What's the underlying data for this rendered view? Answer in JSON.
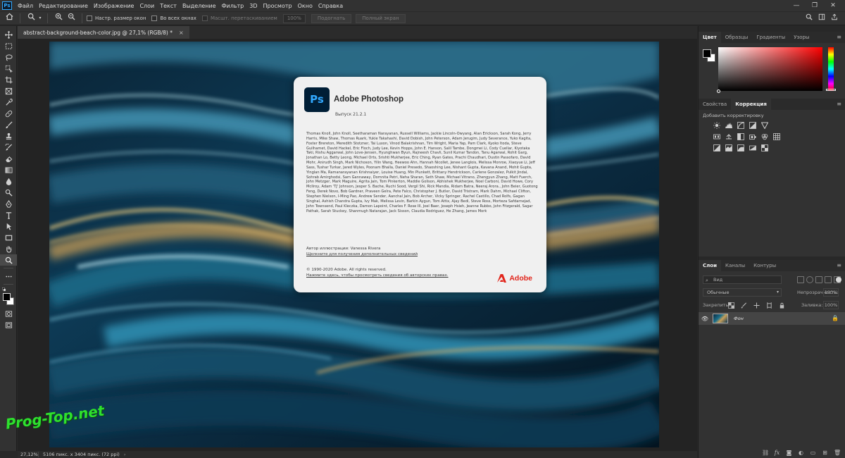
{
  "menubar": {
    "logo": "Ps",
    "items": [
      "Файл",
      "Редактирование",
      "Изображение",
      "Слои",
      "Текст",
      "Выделение",
      "Фильтр",
      "3D",
      "Просмотр",
      "Окно",
      "Справка"
    ],
    "win": {
      "minimize": "—",
      "maximize": "❐",
      "close": "✕"
    }
  },
  "options": {
    "resize_windows": "Настр. размер окон",
    "all_windows": "Во всех окнах",
    "scrubby_zoom": "Масшт. перетаскиванием",
    "zoom_value": "100%",
    "fit_screen": "Подогнать",
    "fill_screen": "Полный экран"
  },
  "document": {
    "tab_title": "abstract-background-beach-color.jpg @ 27,1% (RGB/8) *",
    "close": "×"
  },
  "about": {
    "ps_icon": "Ps",
    "title": "Adobe Photoshop",
    "version": "Выпуск 21.2.1",
    "credits": "Thomas Knoll, John Knoll, Seetharaman Narayanan, Russell Williams, Jackie Lincoln-Owyang, Alan Erickson, Sarah Kong, Jerry Harris, Mike Shaw, Thomas Ruark, Yukie Takahashi, David Dobish, John Peterson, Adam Jerugim, Judy Severance, Yuko Kagita, Foster Brereton, Meredith Stotzner, Tai Luxon, Vinod Balakrishnan, Tim Wright, Maria Yap, Pam Clark, Kyoko Itoda, Steve Guilhamet, David Hackel, Eric Floch, Judy Lee, Kevin Hopps, John E. Hanson, Salil Tambe, Dongmei Li, Cody Cuellar, Kiyotaka Taki, Rishu Aggarwal, John Love-Jensen, Hyunghwan Byun, Rajneesh Chavli, Sunil Kumar Tandon, Tanu Agarwal, Rohit Garg, Jonathan Lo, Betty Leong, Michael Orts, Srishti Mukherjee, Eric Ching, Ryan Gates, Prachi Chaudhari, Dustin Passofaro, David Mohr, Anirudh Singh, Mark Nichoson, Yilin Wang, Heewoo Ahn, Hannah Nicollet, Jenee Langlois, Melissa Monroe, Xiaoyue Li, Jeff Sass, Tushar Turkar, Jared Wyles, Poonam Bhalla, Daniel Presedo, Shaoshing Lee, Nishant Gupta, Kavana Anand, Mohit Gupta, Yinglan Ma, Ramanarayanan Krishnaiyer, Louise Huang, Min Plunkett, Brittany Hendrickson, Carlene Gonzalez, Pulkit Jindal, Sohrab Amirghodsi, Sam Gannaway, Domnita Petri, Neha Sharan, Seth Shaw, Michael Vitrano, Zhengyun Zhang, Matt Fuerch, John Metzger, Mark Maguire, Agrita Jain, Tom Pinkerton, Maddie Golison, Abhishek Mukherjee, Noel Carboni, David Howe, Cory McIlroy, Adam 'TJ' Johnson, Jesper S. Bache, Ruchi Sood, Vergil Shi, Rick Mandia, Ridam Batra, Neeraj Arora., John Beier, Guotong Feng, Derek Novo, Bob Gardner, Praveen Gelra, Pete Falco, Christopher J. Butler, David Tristram, Mark Dahm, Michael Clifton, Stephen Nielson, I-Ming Pao, Andrew Sender, Aanchal Jain, Bob Archer, Vicky Springer, Rachel Castillo, Chad Rolfs, Gagan Singhal, Ashish Chandra Gupta, Ivy Mak, Melissa Levin, Barkin Aygun, Tom Attix, Ajay Bedi, Steve Ross, Morteza Safdarnejad, John Townsend, Paul Kleczka, Damon Lapoint, Charles F. Rose III, Joel Baer, Joseph Hsieh, Jeanne Rubbo, John Fitzgerald, Sagar Pathak, Sarah Stuckey, Shanmugh Natarajan, Jack Sisson, Claudia Rodriguez, He Zhang, James Mork",
    "illustration_author": "Автор иллюстрации: Vanessa Rivera",
    "illustration_link": "Щелкните для получения дополнительных сведений",
    "copyright": "© 1990-2020 Adobe. All rights reserved.",
    "legal_link": "Нажмите здесь, чтобы просмотреть сведения об авторских правах.",
    "adobe_logo": "Adobe"
  },
  "watermark": "Prog-Top.net",
  "status": {
    "zoom": "27,12%",
    "info": "5106 пикс. x 3404 пикс. (72 ppi)",
    "arrow": "›"
  },
  "panels": {
    "color_tabs": [
      "Цвет",
      "Образцы",
      "Градиенты",
      "Узоры"
    ],
    "adjust_tabs": [
      "Свойства",
      "Коррекция"
    ],
    "adjust_title": "Добавить корректировку",
    "layer_tabs": [
      "Слои",
      "Каналы",
      "Контуры"
    ],
    "menu_icon": "≡",
    "layers": {
      "search_placeholder": "Вид",
      "blend_mode": "Обычные",
      "opacity_label": "Непрозрачность:",
      "opacity_value": "100%",
      "lock_label": "Закрепить:",
      "fill_label": "Заливка:",
      "fill_value": "100%",
      "layer_name": "Фон"
    }
  },
  "colors": {
    "accent": "#31a8ff",
    "adobe_red": "#e1251b",
    "watermark": "#2ee02e"
  }
}
